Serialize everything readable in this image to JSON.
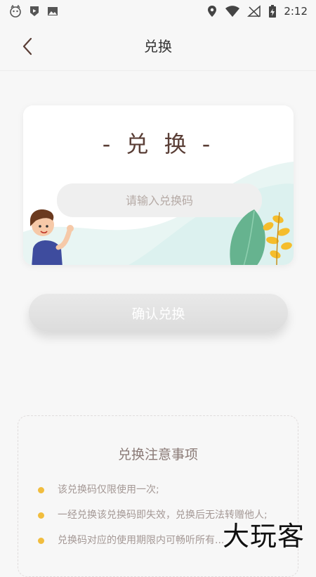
{
  "status_bar": {
    "time": "2:12",
    "icons": [
      "app-icon",
      "play-icon",
      "image-icon",
      "location-icon",
      "wifi-icon",
      "no-signal-icon",
      "battery-charging-icon"
    ]
  },
  "nav": {
    "title": "兑换",
    "back_icon": "chevron-left-icon"
  },
  "card": {
    "title": "- 兑 换 -",
    "input_placeholder": "请输入兑换码",
    "input_value": ""
  },
  "confirm_button": {
    "label": "确认兑换"
  },
  "notice": {
    "title": "兑换注意事项",
    "items": [
      "该兑换码仅限使用一次;",
      "一经兑换该兑换码即失效，兑换后无法转赠他人;",
      "兑换码对应的使用期限内可畅听所有..."
    ]
  },
  "watermark": "大玩客",
  "colors": {
    "title_text": "#5a3e36",
    "bullet": "#f1bd3e",
    "button_bg": "#e2e2e2",
    "card_wave": "#e8f5f3"
  }
}
